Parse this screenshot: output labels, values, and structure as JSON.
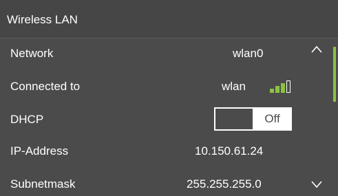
{
  "header": {
    "title": "Wireless LAN"
  },
  "rows": [
    {
      "label": "Network",
      "value": "wlan0"
    },
    {
      "label": "Connected to",
      "value": "wlan",
      "signal_strength": 0.75
    },
    {
      "label": "DHCP",
      "toggle": {
        "state": "Off",
        "on": false
      }
    },
    {
      "label": "IP-Address",
      "value": "10.150.61.24"
    },
    {
      "label": "Subnetmask",
      "value": "255.255.255.0"
    }
  ],
  "colors": {
    "background": "#4b4b4b",
    "accent": "#8ac33e",
    "text": "#ffffff"
  },
  "icons": {
    "scroll_up": "chevron-up-icon",
    "scroll_down": "chevron-down-icon",
    "signal": "wifi-signal-icon"
  }
}
